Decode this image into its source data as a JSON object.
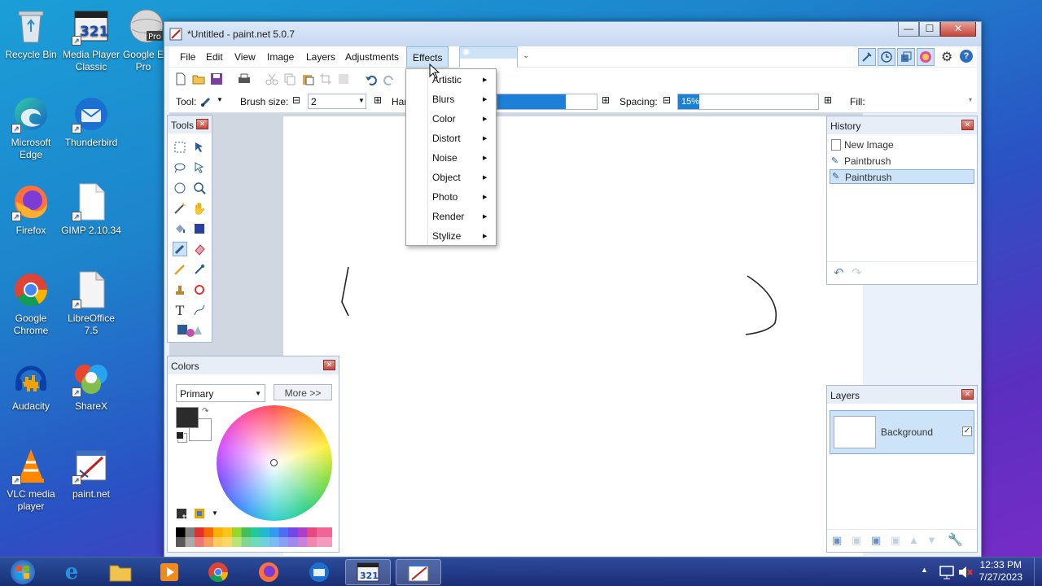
{
  "desktop": {
    "icons": [
      {
        "name": "recycle-bin",
        "label": "Recycle Bin"
      },
      {
        "name": "media-player-classic",
        "label": "Media Player Classic"
      },
      {
        "name": "google-earth-pro",
        "label": "Google E Pro"
      },
      {
        "name": "microsoft-edge",
        "label": "Microsoft Edge"
      },
      {
        "name": "thunderbird",
        "label": "Thunderbird"
      },
      {
        "name": "firefox",
        "label": "Firefox"
      },
      {
        "name": "gimp",
        "label": "GIMP 2.10.34"
      },
      {
        "name": "google-chrome",
        "label": "Google Chrome"
      },
      {
        "name": "libreoffice",
        "label": "LibreOffice 7.5"
      },
      {
        "name": "audacity",
        "label": "Audacity"
      },
      {
        "name": "sharex",
        "label": "ShareX"
      },
      {
        "name": "vlc",
        "label": "VLC media player"
      },
      {
        "name": "paintnet",
        "label": "paint.net"
      }
    ]
  },
  "window": {
    "title": "*Untitled - paint.net 5.0.7",
    "controls": {
      "minimize": "—",
      "maximize": "☐",
      "close": "✕"
    }
  },
  "menu": {
    "items": [
      "File",
      "Edit",
      "View",
      "Image",
      "Layers",
      "Adjustments",
      "Effects"
    ]
  },
  "effects_menu": {
    "items": [
      "Artistic",
      "Blurs",
      "Color",
      "Distort",
      "Noise",
      "Object",
      "Photo",
      "Render",
      "Stylize"
    ]
  },
  "toolbar": {
    "tool_label": "Tool:",
    "brush_size_label": "Brush size:",
    "brush_size_value": "2",
    "hardness_label": "Har",
    "spacing_label": "Spacing:",
    "spacing_value": "15%",
    "fill_label": "Fill:"
  },
  "tools_panel": {
    "title": "Tools"
  },
  "colors_panel": {
    "title": "Colors",
    "mode": "Primary",
    "more_button": "More >>"
  },
  "history_panel": {
    "title": "History",
    "items": [
      "New Image",
      "Paintbrush",
      "Paintbrush"
    ]
  },
  "layers_panel": {
    "title": "Layers",
    "layer_name": "Background"
  },
  "taskbar": {
    "time": "12:33 PM",
    "date": "7/27/2023"
  },
  "colors": {
    "accent": "#1e7fd6",
    "selection": "#cde3f7",
    "titlebar": "#c7d9f0"
  }
}
